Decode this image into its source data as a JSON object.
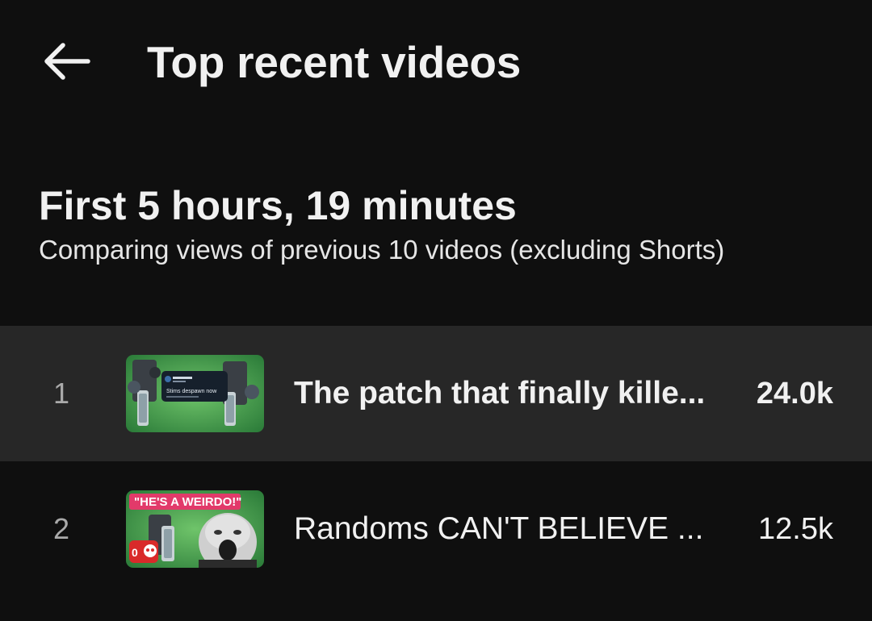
{
  "header": {
    "title": "Top recent videos",
    "back_icon": "arrow-left-icon"
  },
  "section": {
    "title": "First 5 hours, 19 minutes",
    "subtitle": "Comparing views of previous 10 videos (excluding Shorts)"
  },
  "videos": [
    {
      "rank": "1",
      "title": "The patch that finally kille...",
      "views": "24.0k",
      "thumbnail": {
        "description_icon": "video-thumbnail-icon",
        "overlay_text": "Stims despawn now"
      }
    },
    {
      "rank": "2",
      "title": "Randoms CAN'T BELIEVE ...",
      "views": "12.5k",
      "thumbnail": {
        "description_icon": "video-thumbnail-icon",
        "overlay_text": "\"HE'S A WEIRDO!\""
      }
    }
  ],
  "colors": {
    "background": "#0f0f0f",
    "highlight_row": "#272727",
    "text_primary": "#f1f1f1",
    "text_secondary": "#aaaaaa"
  }
}
